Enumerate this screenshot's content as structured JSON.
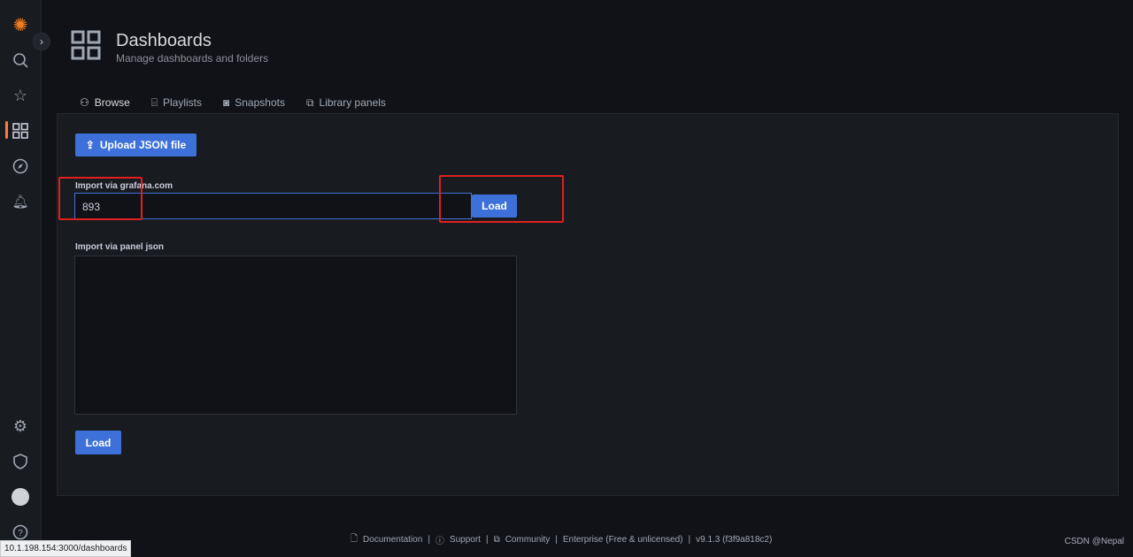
{
  "header": {
    "title": "Dashboards",
    "subtitle": "Manage dashboards and folders"
  },
  "tabs": [
    {
      "label": "Browse",
      "icon": "sitemap-icon"
    },
    {
      "label": "Playlists",
      "icon": "presentation-icon"
    },
    {
      "label": "Snapshots",
      "icon": "camera-icon"
    },
    {
      "label": "Library panels",
      "icon": "library-panel-icon"
    }
  ],
  "upload": {
    "label": "Upload JSON file"
  },
  "grafana_import": {
    "label": "Import via grafana.com",
    "value": "893",
    "load": "Load"
  },
  "panel_json": {
    "label": "Import via panel json",
    "load": "Load"
  },
  "footer": {
    "documentation": "Documentation",
    "support": "Support",
    "community": "Community",
    "edition": "Enterprise (Free & unlicensed)",
    "version": "v9.1.3 (f3f9a818c2)"
  },
  "status_url": "10.1.198.154:3000/dashboards",
  "watermark": "CSDN @Nepal",
  "colors": {
    "primary": "#3d71d9",
    "accent": "#ff7941",
    "highlight": "#e02020"
  }
}
